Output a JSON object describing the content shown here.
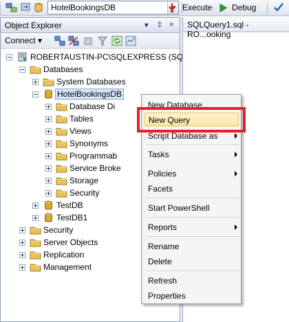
{
  "toolbar": {
    "database": "HotelBookingsDB",
    "execute_label": "Execute",
    "debug_label": "Debug"
  },
  "object_explorer": {
    "title": "Object Explorer",
    "pin_glyph": "▾ ‡ ×",
    "connect_label": "Connect ▾"
  },
  "tree": [
    {
      "label": "ROBERTAUSTIN-PC\\SQLEXPRESS (SQL",
      "icon": "server-icon",
      "expander": "minus"
    },
    {
      "label": "Databases",
      "icon": "folder-icon",
      "expander": "minus"
    },
    {
      "label": "System Databases",
      "icon": "folder-icon",
      "expander": "plus"
    },
    {
      "label": "HotelBookingsDB",
      "icon": "database-icon",
      "expander": "minus"
    },
    {
      "label": "Database Di",
      "icon": "folder-icon",
      "expander": "plus"
    },
    {
      "label": "Tables",
      "icon": "folder-icon",
      "expander": "plus"
    },
    {
      "label": "Views",
      "icon": "folder-icon",
      "expander": "plus"
    },
    {
      "label": "Synonyms",
      "icon": "folder-icon",
      "expander": "plus"
    },
    {
      "label": "Programmab",
      "icon": "folder-icon",
      "expander": "plus"
    },
    {
      "label": "Service Broke",
      "icon": "folder-icon",
      "expander": "plus"
    },
    {
      "label": "Storage",
      "icon": "folder-icon",
      "expander": "plus"
    },
    {
      "label": "Security",
      "icon": "folder-icon",
      "expander": "plus"
    },
    {
      "label": "TestDB",
      "icon": "database-icon",
      "expander": "plus"
    },
    {
      "label": "TestDB1",
      "icon": "database-icon",
      "expander": "plus"
    },
    {
      "label": "Security",
      "icon": "folder-icon",
      "expander": "plus"
    },
    {
      "label": "Server Objects",
      "icon": "folder-icon",
      "expander": "plus"
    },
    {
      "label": "Replication",
      "icon": "folder-icon",
      "expander": "plus"
    },
    {
      "label": "Management",
      "icon": "folder-icon",
      "expander": "plus"
    }
  ],
  "editor_tab": {
    "title": "SQLQuery1.sql - RO...ooking"
  },
  "context_menu": {
    "items": [
      {
        "label": "New Database...",
        "submenu": false
      },
      {
        "label": "New Query",
        "submenu": false,
        "highlighted": true
      },
      {
        "label": "Script Database as",
        "submenu": true
      },
      {
        "label": "Tasks",
        "submenu": true
      },
      {
        "label": "Policies",
        "submenu": true
      },
      {
        "label": "Facets",
        "submenu": false
      },
      {
        "label": "Start PowerShell",
        "submenu": false
      },
      {
        "label": "Reports",
        "submenu": true
      },
      {
        "label": "Rename",
        "submenu": false
      },
      {
        "label": "Delete",
        "submenu": false
      },
      {
        "label": "Refresh",
        "submenu": false
      },
      {
        "label": "Properties",
        "submenu": false
      }
    ]
  },
  "colors": {
    "highlight_border": "#e51f2a",
    "selection": "#d7e7fb",
    "folder": "#e8c25a",
    "database": "#d9a733"
  }
}
